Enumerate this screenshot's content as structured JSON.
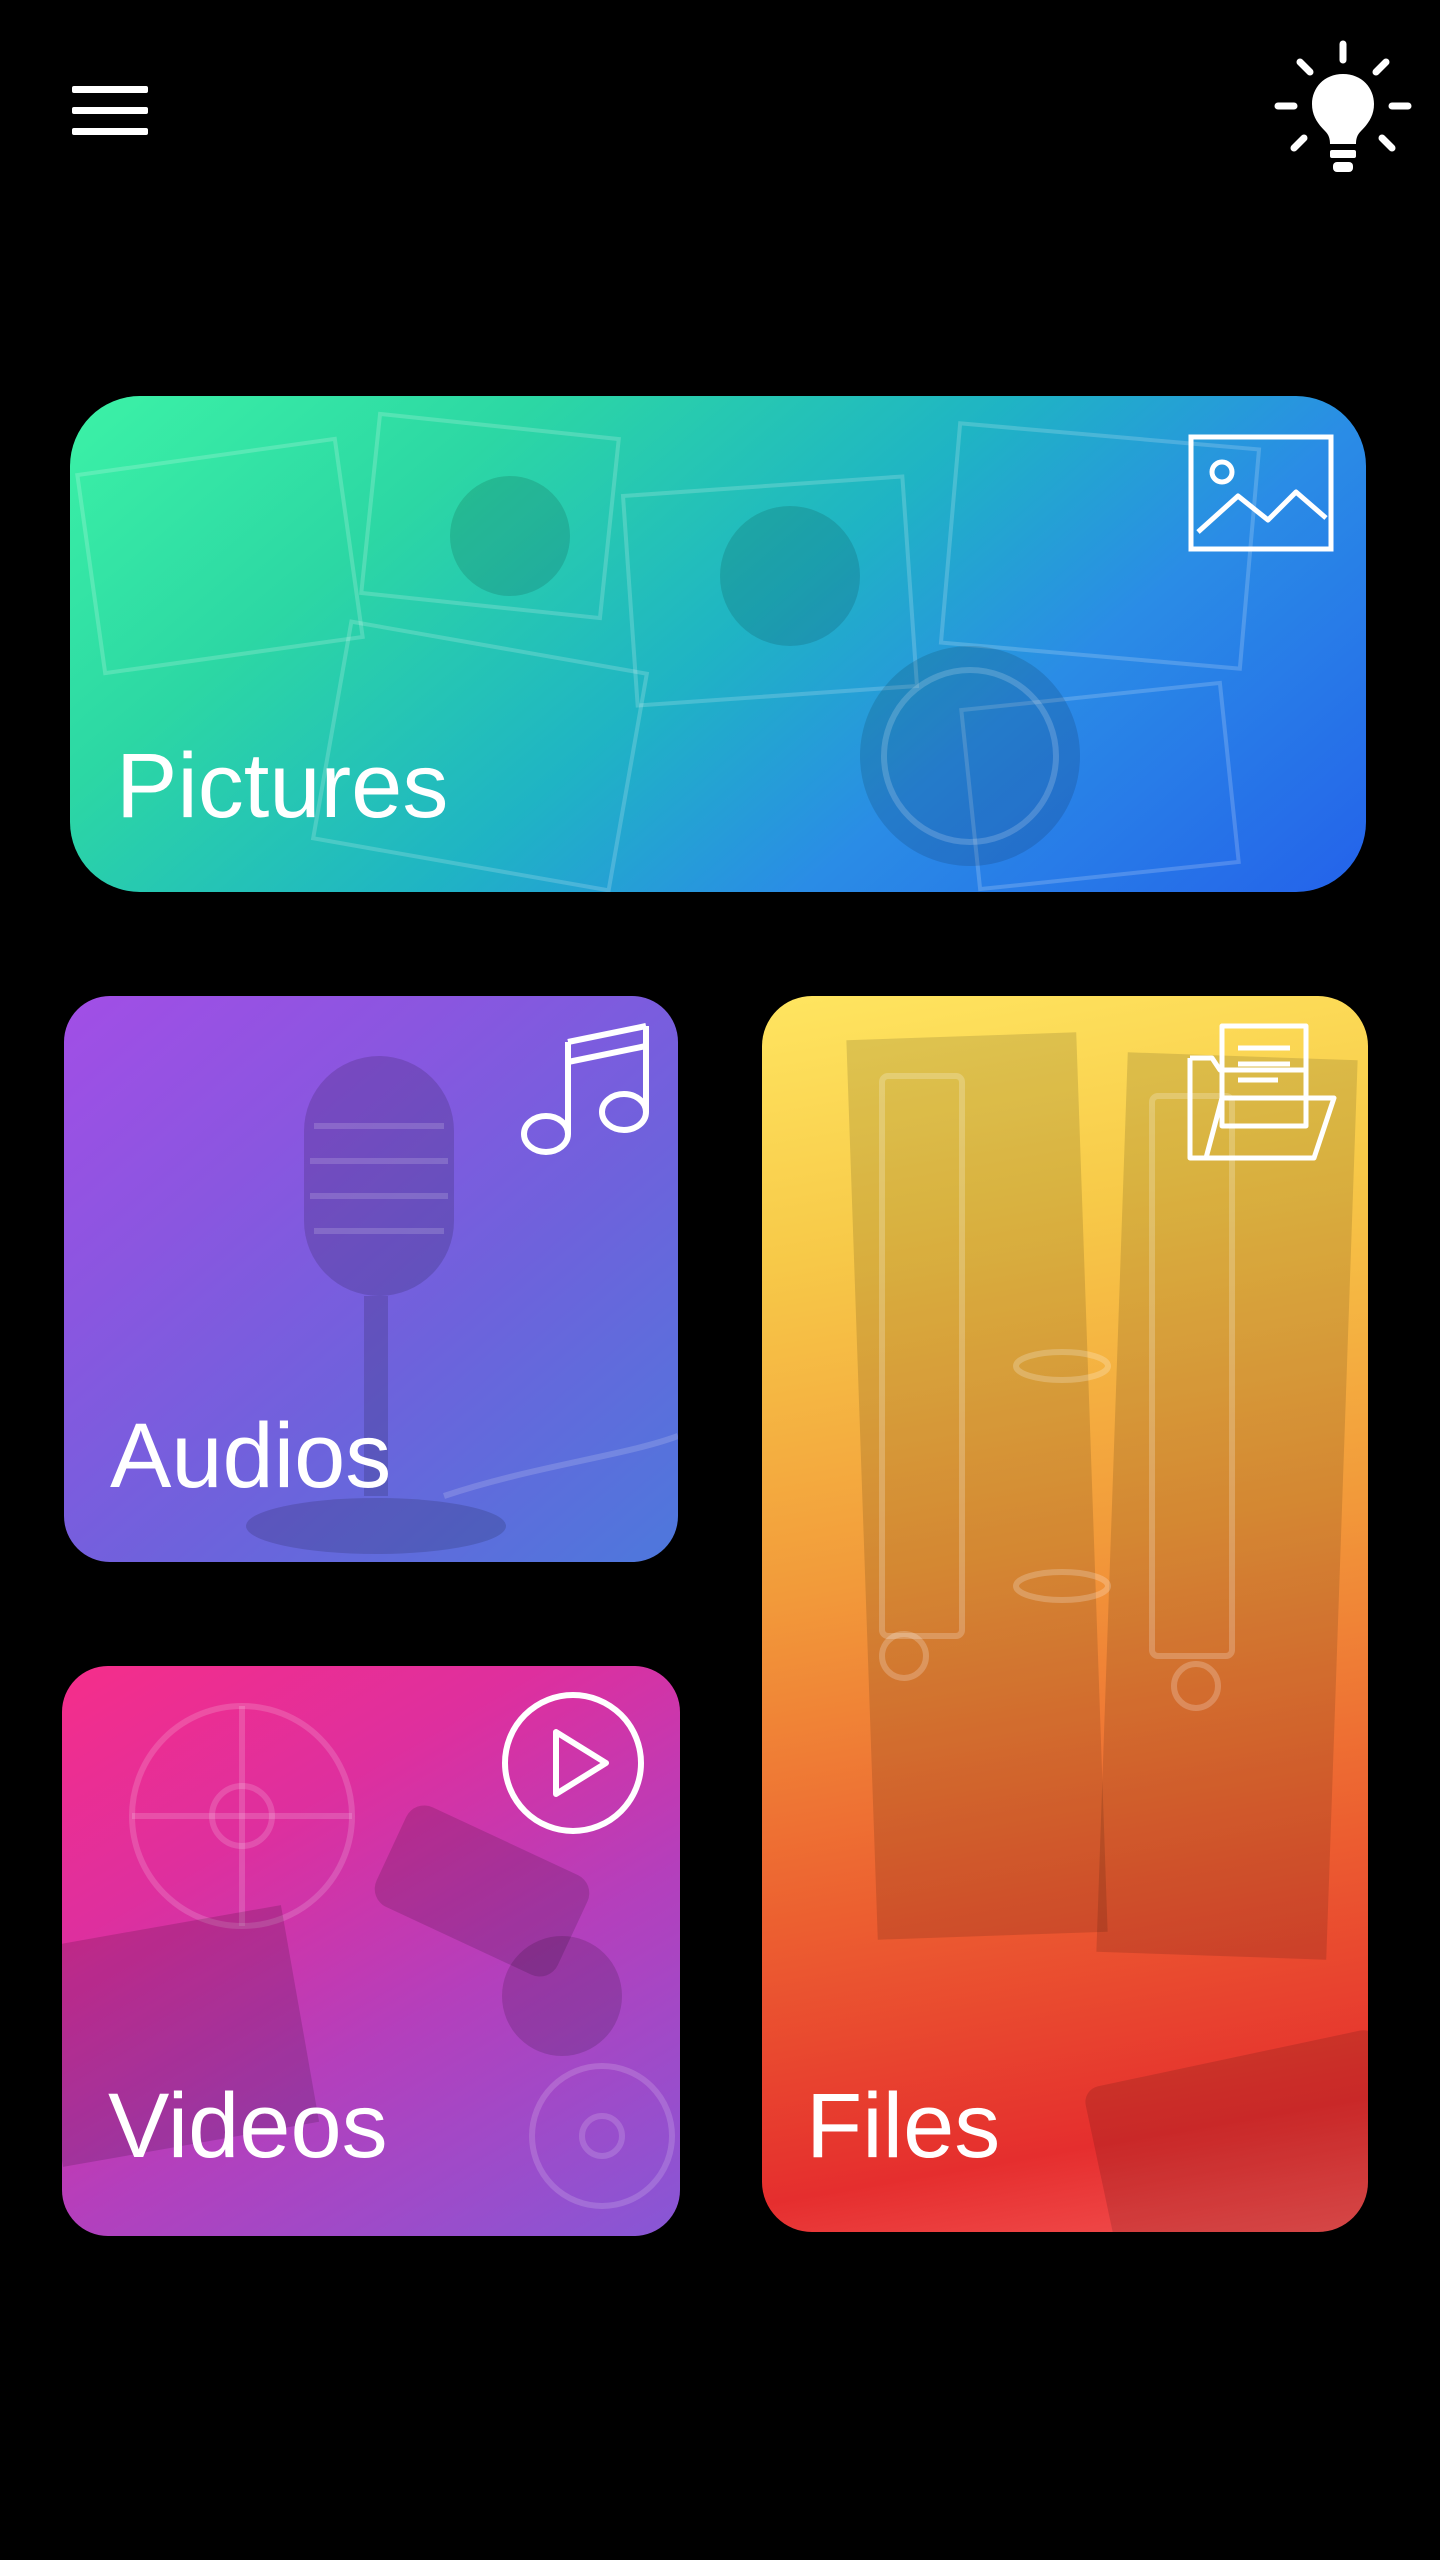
{
  "app": {
    "background_color": "#000000",
    "foreground_color": "#ffffff"
  },
  "header": {
    "menu_icon": "hamburger-menu-icon",
    "theme_icon": "lightbulb-icon"
  },
  "categories": [
    {
      "id": "pictures",
      "label": "Pictures",
      "icon": "image-icon",
      "gradient": [
        "#3cf2a6",
        "#2cd7a4",
        "#1fb4c4",
        "#2a8ce6",
        "#2462ea"
      ]
    },
    {
      "id": "audios",
      "label": "Audios",
      "icon": "music-note-icon",
      "gradient": [
        "#a24ee6",
        "#8a56e0",
        "#6e62dc",
        "#4d78dc"
      ]
    },
    {
      "id": "videos",
      "label": "Videos",
      "icon": "play-circle-icon",
      "gradient": [
        "#f52e8a",
        "#de2f9e",
        "#b43fbc",
        "#8757d6"
      ]
    },
    {
      "id": "files",
      "label": "Files",
      "icon": "documents-folder-icon",
      "gradient": [
        "#ffe560",
        "#f7c948",
        "#f29a3a",
        "#ec5e30",
        "#e52e2e"
      ]
    }
  ]
}
